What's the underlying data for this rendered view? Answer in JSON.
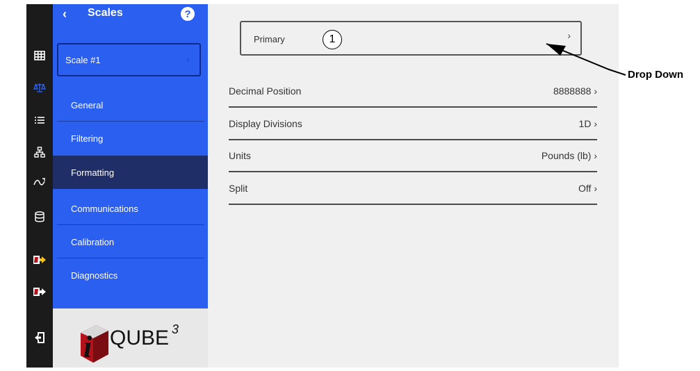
{
  "rail": {
    "icons": [
      "grid-icon",
      "scale-icon",
      "list-icon",
      "network-icon",
      "flow-icon",
      "database-icon",
      "import-icon",
      "export-icon",
      "logout-icon"
    ]
  },
  "sidebar": {
    "back": "‹",
    "title": "Scales",
    "help": "?",
    "scale_selector": {
      "label": "Scale #1",
      "chevron": "›"
    },
    "items": [
      {
        "label": "General"
      },
      {
        "label": "Filtering"
      },
      {
        "label": "Formatting"
      },
      {
        "label": "Communications"
      },
      {
        "label": "Calibration"
      },
      {
        "label": "Diagnostics"
      }
    ],
    "active_index": 2,
    "logo": {
      "text": "QUBE",
      "superscript": "3",
      "mark": "i"
    }
  },
  "main": {
    "primary_dropdown": {
      "label": "Primary",
      "chevron": "›"
    },
    "callout_number": "1",
    "rows": [
      {
        "label": "Decimal Position",
        "value": "8888888 ›"
      },
      {
        "label": "Display Divisions",
        "value": "1D ›"
      },
      {
        "label": "Units",
        "value": "Pounds (lb) ›"
      },
      {
        "label": "Split",
        "value": "Off ›"
      }
    ]
  },
  "annotation": {
    "label": "Drop Down"
  },
  "colors": {
    "sidebar": "#2b5ff0",
    "active": "#1f2e66",
    "rail": "#1b1b1b",
    "rail_active_icon": "#2b5ff0"
  }
}
